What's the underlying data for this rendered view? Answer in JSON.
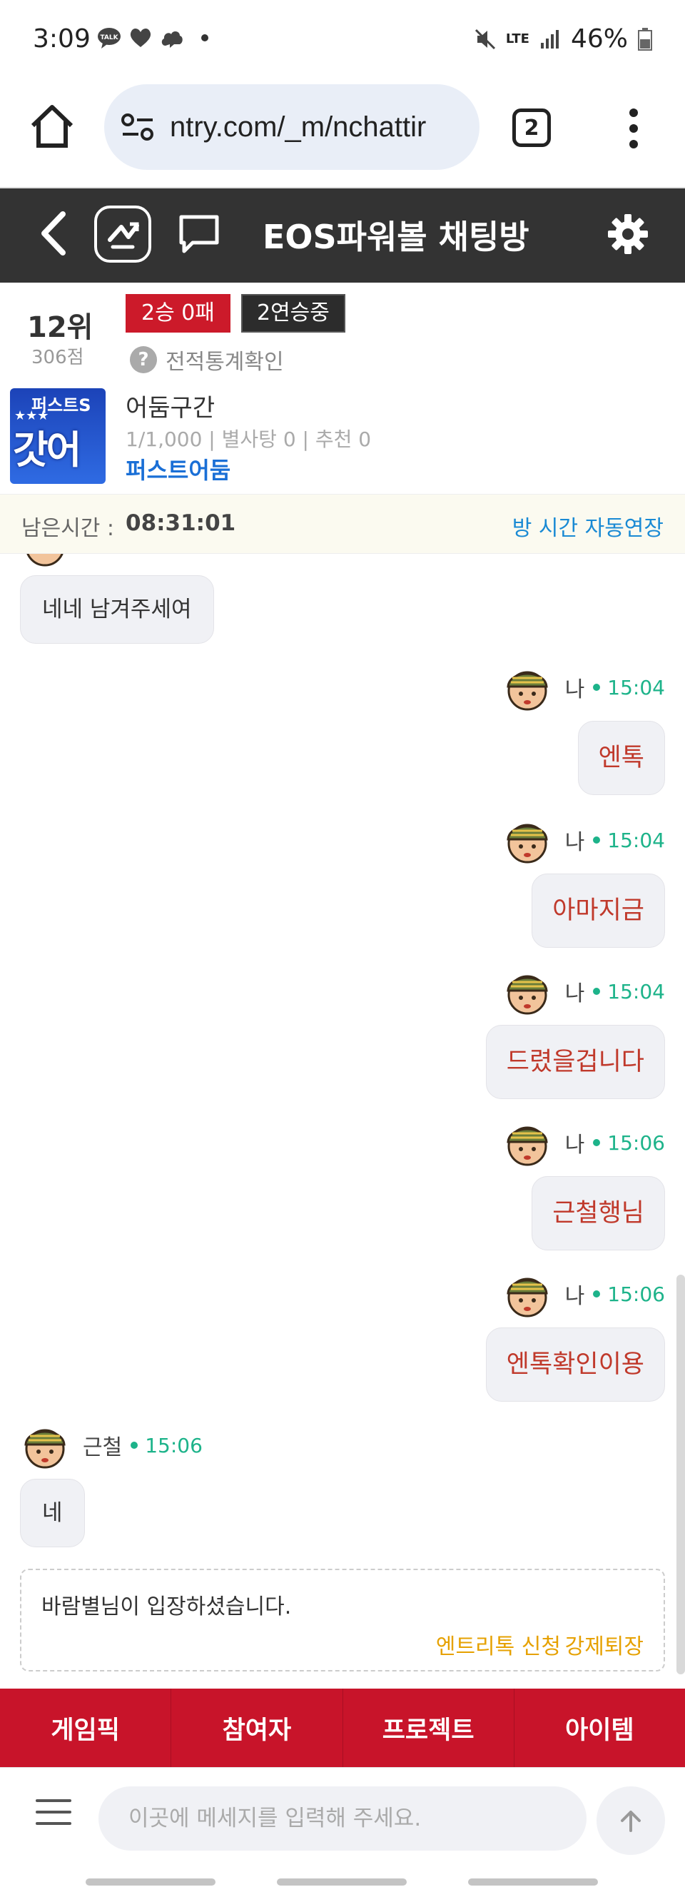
{
  "status_bar": {
    "time": "3:09",
    "notif_icons": [
      "talk-icon",
      "heart-icon",
      "cloud-icon"
    ],
    "lte": "LTE",
    "battery": "46%"
  },
  "browser": {
    "url": "ntry.com/_m/nchattir",
    "tab_count": "2"
  },
  "header": {
    "title": "EOS파워볼 채팅방"
  },
  "profile": {
    "rank": "12위",
    "score": "306점",
    "record_badge": "2승 0패",
    "streak_badge": "2연승중",
    "stats_link": "전적통계확인",
    "room_name": "어둠구간",
    "room_meta": "1/1,000 | 별사탕 0 | 추천 0",
    "owner": "퍼스트어둠",
    "thumb_text_top": "퍼스트S",
    "thumb_stars": "★★★",
    "thumb_text_main": "갓어둠"
  },
  "timer": {
    "label": "남은시간 :",
    "value": "08:31:01",
    "extend": "방 시간 자동연장"
  },
  "chat": {
    "messages": [
      {
        "side": "left",
        "text": "네네 남겨주세여"
      },
      {
        "side": "right",
        "nick": "나",
        "time": "15:04",
        "text": "엔톡"
      },
      {
        "side": "right",
        "nick": "나",
        "time": "15:04",
        "text": "아마지금"
      },
      {
        "side": "right",
        "nick": "나",
        "time": "15:04",
        "text": "드렸을겁니다"
      },
      {
        "side": "right",
        "nick": "나",
        "time": "15:06",
        "text": "근철행님"
      },
      {
        "side": "right",
        "nick": "나",
        "time": "15:06",
        "text": "엔톡확인이용"
      },
      {
        "side": "left",
        "nick": "근철",
        "time": "15:06",
        "text": "네"
      }
    ],
    "system": {
      "message": "바람별님이 입장하셨습니다.",
      "btn_invite": "엔트리톡 신청",
      "btn_kick": "강제퇴장"
    }
  },
  "tabs": [
    "게임픽",
    "참여자",
    "프로젝트",
    "아이템"
  ],
  "input": {
    "placeholder": "이곳에 메세지를 입력해 주세요."
  },
  "colors": {
    "header_bg": "#333333",
    "accent_red": "#c8142a",
    "time_green": "#1db38a",
    "link_blue": "#1a6fd6",
    "action_yellow": "#e6a100"
  }
}
